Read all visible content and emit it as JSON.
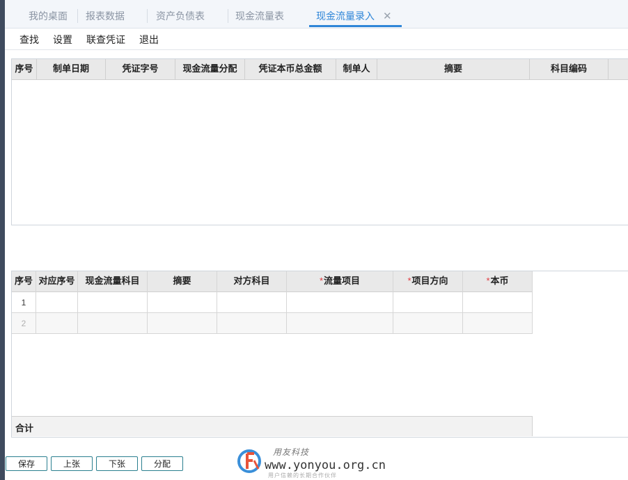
{
  "tabs": [
    {
      "label": "我的桌面"
    },
    {
      "label": "报表数据"
    },
    {
      "label": "资产负债表"
    },
    {
      "label": "现金流量表"
    },
    {
      "label": "现金流量录入",
      "active": true,
      "close": "✕"
    }
  ],
  "toolbar": {
    "find": "查找",
    "settings": "设置",
    "linked_voucher": "联查凭证",
    "exit": "退出"
  },
  "voucher_grid": {
    "columns": [
      "序号",
      "制单日期",
      "凭证字号",
      "现金流量分配",
      "凭证本币总金额",
      "制单人",
      "摘要",
      "科目编码"
    ],
    "rows": []
  },
  "detail_grid": {
    "columns": [
      "序号",
      "对应序号",
      "现金流量科目",
      "摘要",
      "对方科目",
      "流量项目",
      "项目方向",
      "本币"
    ],
    "required_marker": "*",
    "rows": [
      {
        "index": "1"
      },
      {
        "index": "2"
      }
    ],
    "total_label": "合计"
  },
  "buttons": {
    "save": "保存",
    "prev": "上张",
    "next": "下张",
    "allocate": "分配"
  },
  "watermark": {
    "title": "用友科技",
    "url": "www.yonyou.org.cn",
    "subtitle": "用户信赖的长期合作伙伴"
  },
  "colors": {
    "accent": "#2f86d8",
    "required": "#e0393e",
    "button_border": "#2a7f8f"
  }
}
